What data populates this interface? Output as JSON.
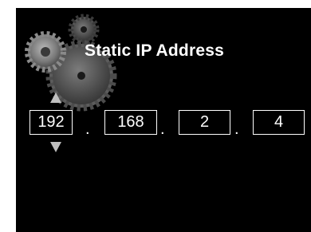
{
  "screen": {
    "title": "Static IP Address",
    "background_color": "#000000",
    "decoration_icon": "gears-icon"
  },
  "ip_address": {
    "octets": [
      "192",
      "168",
      "2",
      "4"
    ],
    "separator": ".",
    "selected_octet_index": 0
  },
  "spinner": {
    "up_icon": "arrow-up-icon",
    "down_icon": "arrow-down-icon",
    "color": "#bfbfbf"
  }
}
